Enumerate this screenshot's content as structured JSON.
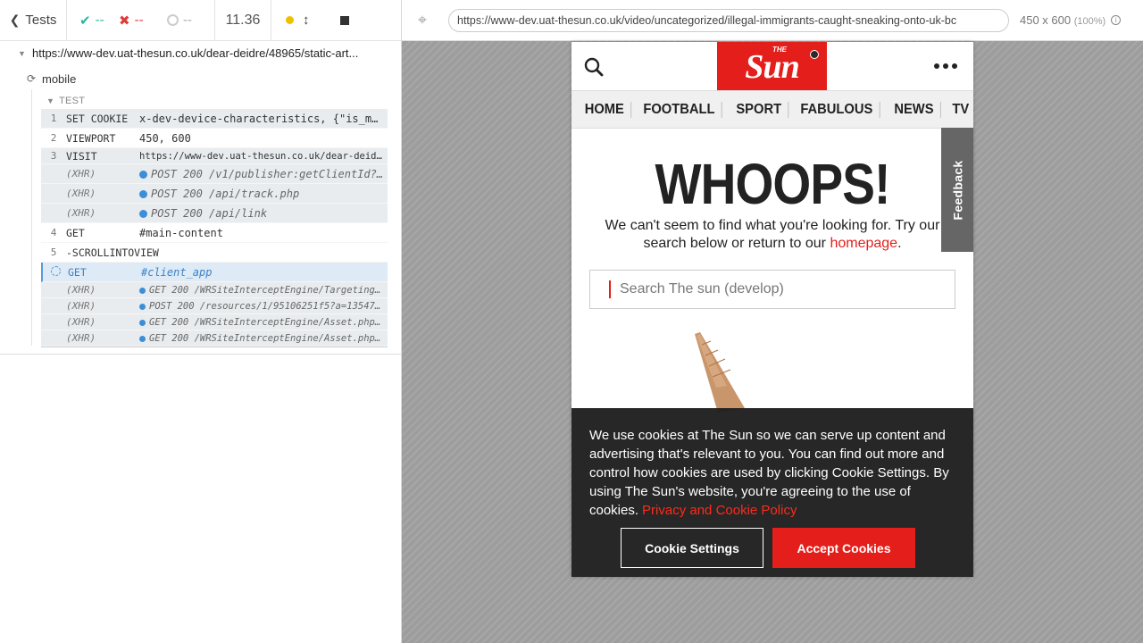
{
  "reporter": {
    "header": {
      "tests_label": "Tests",
      "passed": "--",
      "failed": "--",
      "pending": "--",
      "duration": "11.36"
    },
    "runnable_url": "https://www-dev.uat-thesun.co.uk/dear-deidre/48965/static-art...",
    "suite": "mobile",
    "test": "TEST",
    "commands": [
      {
        "num": "1",
        "name": "SET COOKIE",
        "message": "x-dev-device-characteristics, {\"is_m..."
      },
      {
        "num": "2",
        "name": "VIEWPORT",
        "message": "450, 600"
      },
      {
        "num": "3",
        "name": "VISIT",
        "message": "https://www-dev.uat-thesun.co.uk/dear-deidr..."
      },
      {
        "num": "",
        "name": "(XHR)",
        "message": "POST 200 /v1/publisher:getClientId?..."
      },
      {
        "num": "",
        "name": "(XHR)",
        "message": "POST 200 /api/track.php"
      },
      {
        "num": "",
        "name": "(XHR)",
        "message": "POST 200 /api/link"
      },
      {
        "num": "4",
        "name": "GET",
        "message": "#main-content"
      },
      {
        "num": "5",
        "name": "-SCROLLINTOVIEW",
        "message": ""
      },
      {
        "num": "",
        "name": "GET",
        "message": "#client_app"
      },
      {
        "num": "",
        "name": "(XHR)",
        "message": "GET 200 /WRSiteInterceptEngine/Targeting..."
      },
      {
        "num": "",
        "name": "(XHR)",
        "message": "POST 200 /resources/1/95106251f5?a=135478..."
      },
      {
        "num": "",
        "name": "(XHR)",
        "message": "GET 200 /WRSiteInterceptEngine/Asset.php?..."
      },
      {
        "num": "",
        "name": "(XHR)",
        "message": "GET 200 /WRSiteInterceptEngine/Asset.php?..."
      }
    ]
  },
  "aut": {
    "url": "https://www-dev.uat-thesun.co.uk/video/uncategorized/illegal-immigrants-caught-sneaking-onto-uk-bc",
    "viewport": "450 x 600",
    "zoom": "(100%)"
  },
  "site": {
    "logo_small": "THE",
    "logo_text": "Sun",
    "nav": [
      "HOME",
      "FOOTBALL",
      "SPORT",
      "FABULOUS",
      "NEWS",
      "TV & SHOWBI"
    ],
    "heading": "WHOOPS!",
    "notfound_text": "We can't seem to find what you're looking for. Try our search below or return to our ",
    "homepage_link": "homepage",
    "notfound_end": ".",
    "feedback": "Feedback",
    "search_placeholder": "Search The sun (develop)",
    "cookie": {
      "text": "We use cookies at The Sun so we can serve up content and advertising that's relevant to you. You can find out more and control how cookies are used by clicking Cookie Settings. By using The Sun's website, you're agreeing to the use of cookies.",
      "policy_link": "Privacy and Cookie Policy",
      "settings_button": "Cookie Settings",
      "accept_button": "Accept Cookies"
    }
  },
  "colors": {
    "brand_red": "#e41f1b",
    "pass": "#2bb3a0",
    "fail": "#e03b3b",
    "active_blue": "#3a83c7"
  }
}
